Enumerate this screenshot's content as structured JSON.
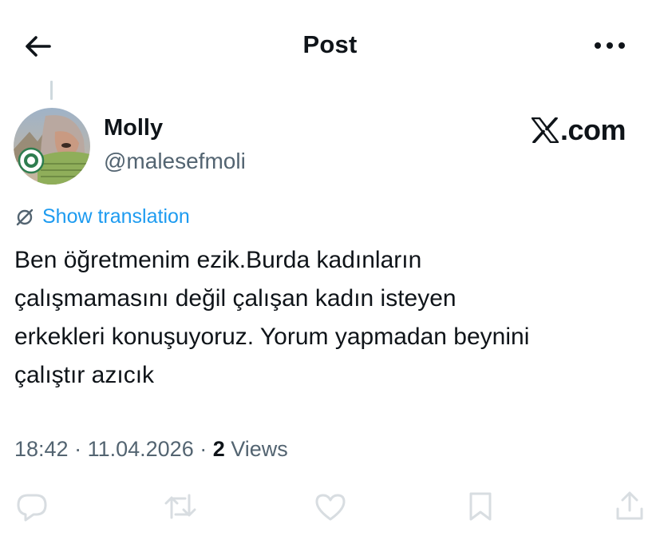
{
  "header": {
    "title": "Post"
  },
  "author": {
    "display_name": "Molly",
    "handle": "@malesefmoli"
  },
  "watermark": {
    "text": ".com"
  },
  "translate": {
    "label": "Show translation"
  },
  "post": {
    "text": "Ben öğretmenim ezik.Burda kadınların\nçalışmamasını değil çalışan kadın isteyen\nerkekleri konuşuyoruz. Yorum yapmadan beynini\nçalıştır azıcık"
  },
  "meta": {
    "time": "18:42",
    "sep1": " · ",
    "date": "11.04.2026",
    "sep2": " · ",
    "views_count": "2",
    "views_label": " Views"
  },
  "colors": {
    "accent": "#1d9bf0",
    "text": "#0f1419",
    "secondary": "#536471",
    "action_icon": "#d8dde1",
    "thread_line": "#cfd9de"
  },
  "icons": {
    "back": "arrow-left-icon",
    "more": "more-horizontal-icon",
    "translate": "globe-slash-icon",
    "reply": "reply-icon",
    "repost": "repost-icon",
    "like": "heart-icon",
    "bookmark": "bookmark-icon",
    "share": "share-icon"
  }
}
